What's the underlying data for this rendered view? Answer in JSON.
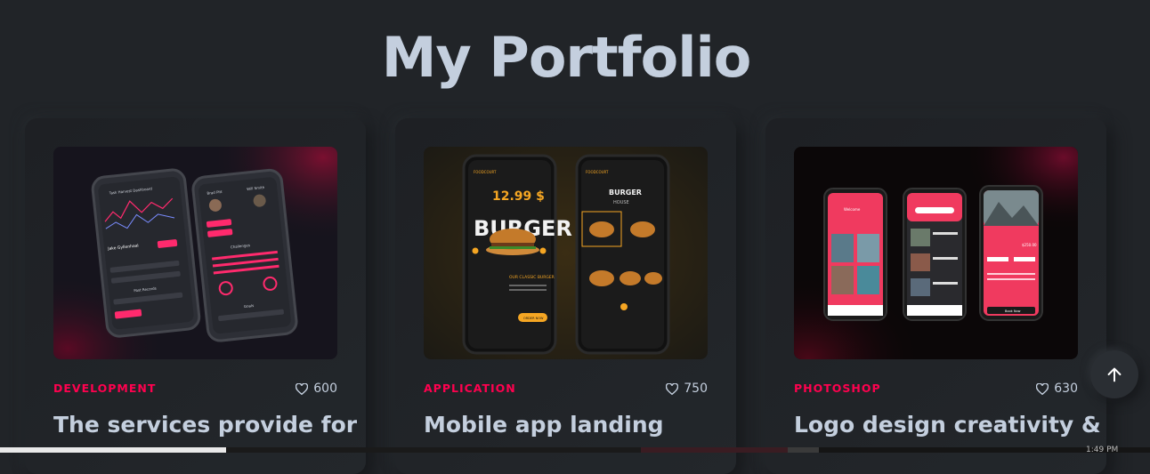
{
  "section": {
    "title": "My Portfolio"
  },
  "cards": [
    {
      "category": "DEVELOPMENT",
      "likes": "600",
      "title": "The services provide for",
      "image_texts": [
        "Task Harvest Dashboard",
        "Jake Gyllenhaal",
        "Brad Pitt",
        "Will Smith",
        "Challenges",
        "Past Records",
        "Goals"
      ]
    },
    {
      "category": "APPLICATION",
      "likes": "750",
      "title": "Mobile app landing",
      "image_texts": [
        "FOODCOURT",
        "12.99 $",
        "BURGER",
        "OUR CLASSIC BURGER",
        "ORDER NOW",
        "BURGER",
        "HOUSE"
      ]
    },
    {
      "category": "PHOTOSHOP",
      "likes": "630",
      "title": "Logo design creativity &",
      "image_texts": [
        "Welcome",
        "To Our Most Popular & Luxurious Places",
        "$250.00",
        "Book Now"
      ]
    }
  ],
  "scroll_top": {
    "icon": "arrow-up-icon"
  },
  "taskbar": {
    "clock": "1:49 PM"
  },
  "colors": {
    "accent": "#ff014f",
    "text": "#c4cfde",
    "background": "#212428"
  }
}
